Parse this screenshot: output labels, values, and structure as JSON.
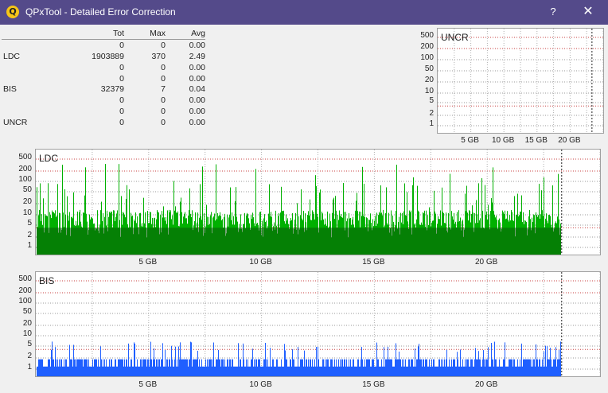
{
  "window": {
    "title": "QPxTool - Detailed Error Correction",
    "help_label": "?",
    "close_label": "✕",
    "app_icon_label": "Q"
  },
  "stats": {
    "headers": [
      "",
      "Tot",
      "Max",
      "Avg"
    ],
    "rows": [
      [
        "",
        "0",
        "0",
        "0.00"
      ],
      [
        "LDC",
        "1903889",
        "370",
        "2.49"
      ],
      [
        "",
        "0",
        "0",
        "0.00"
      ],
      [
        "",
        "0",
        "0",
        "0.00"
      ],
      [
        "BIS",
        "32379",
        "7",
        "0.04"
      ],
      [
        "",
        "0",
        "0",
        "0.00"
      ],
      [
        "",
        "0",
        "0",
        "0.00"
      ],
      [
        "UNCR",
        "0",
        "0",
        "0.00"
      ]
    ]
  },
  "chart_data": [
    {
      "type": "bar",
      "title": "UNCR",
      "y_ticks": [
        "500",
        "200",
        "100",
        "50",
        "20",
        "10",
        "5",
        "2",
        "1"
      ],
      "x_ticks": [
        "5 GB",
        "10 GB",
        "15 GB",
        "20 GB"
      ],
      "x_range_gb": [
        0,
        25
      ],
      "y_scale": "log",
      "values": [],
      "end_gb": 23.3
    },
    {
      "type": "bar",
      "title": "LDC",
      "y_ticks": [
        "500",
        "200",
        "100",
        "50",
        "20",
        "10",
        "5",
        "2",
        "1"
      ],
      "x_ticks": [
        "5 GB",
        "10 GB",
        "15 GB",
        "20 GB"
      ],
      "x_range_gb": [
        0,
        25
      ],
      "y_scale": "log",
      "max": 370,
      "average": 2.49,
      "end_gb": 23.3,
      "color": "#00b000"
    },
    {
      "type": "bar",
      "title": "BIS",
      "y_ticks": [
        "500",
        "200",
        "100",
        "50",
        "20",
        "10",
        "5",
        "2",
        "1"
      ],
      "x_ticks": [
        "5 GB",
        "10 GB",
        "15 GB",
        "20 GB"
      ],
      "x_range_gb": [
        0,
        25
      ],
      "y_scale": "log",
      "max": 7,
      "average": 0.04,
      "end_gb": 23.3,
      "color": "#1f5fff"
    }
  ]
}
